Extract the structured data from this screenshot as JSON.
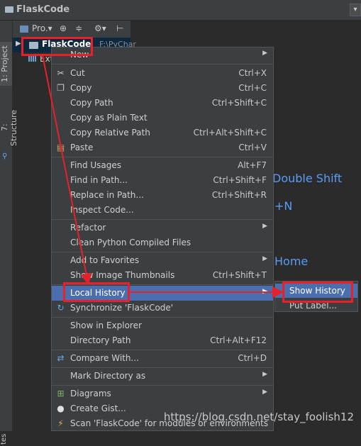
{
  "window": {
    "title": "FlaskCode",
    "dropdown_glyph": "▾"
  },
  "side_tabs": {
    "project": "1: Project",
    "structure": "7: Structure",
    "bottom": "tes"
  },
  "toolbar": {
    "project_label": "Pro.▾",
    "icons": [
      "⊕",
      "≑",
      "⚙▾",
      "⊢"
    ]
  },
  "tree": {
    "root_name": "FlaskCode",
    "root_path": "F:\\PyChar",
    "external_libs": "Ext"
  },
  "hints": {
    "double_shift": "Double Shift",
    "n": "+N",
    "home": "Home"
  },
  "context_menu": {
    "items": [
      {
        "label": "New",
        "shortcut": "",
        "submenu": true,
        "icon": ""
      },
      {
        "label": "Cut",
        "shortcut": "Ctrl+X",
        "submenu": false,
        "icon": "scissors-icon"
      },
      {
        "label": "Copy",
        "shortcut": "Ctrl+C",
        "submenu": false,
        "icon": "copy-icon"
      },
      {
        "label": "Copy Path",
        "shortcut": "Ctrl+Shift+C",
        "submenu": false,
        "icon": ""
      },
      {
        "label": "Copy as Plain Text",
        "shortcut": "",
        "submenu": false,
        "icon": ""
      },
      {
        "label": "Copy Relative Path",
        "shortcut": "Ctrl+Alt+Shift+C",
        "submenu": false,
        "icon": ""
      },
      {
        "label": "Paste",
        "shortcut": "Ctrl+V",
        "submenu": false,
        "icon": "paste-icon"
      },
      {
        "label": "Find Usages",
        "shortcut": "Alt+F7",
        "submenu": false,
        "icon": ""
      },
      {
        "label": "Find in Path...",
        "shortcut": "Ctrl+Shift+F",
        "submenu": false,
        "icon": ""
      },
      {
        "label": "Replace in Path...",
        "shortcut": "Ctrl+Shift+R",
        "submenu": false,
        "icon": ""
      },
      {
        "label": "Inspect Code...",
        "shortcut": "",
        "submenu": false,
        "icon": ""
      },
      {
        "label": "Refactor",
        "shortcut": "",
        "submenu": true,
        "icon": ""
      },
      {
        "label": "Clean Python Compiled Files",
        "shortcut": "",
        "submenu": false,
        "icon": ""
      },
      {
        "label": "Add to Favorites",
        "shortcut": "",
        "submenu": true,
        "icon": ""
      },
      {
        "label": "Show Image Thumbnails",
        "shortcut": "Ctrl+Shift+T",
        "submenu": false,
        "icon": ""
      },
      {
        "label": "Local History",
        "shortcut": "",
        "submenu": true,
        "icon": ""
      },
      {
        "label": "Synchronize 'FlaskCode'",
        "shortcut": "",
        "submenu": false,
        "icon": "sync-icon"
      },
      {
        "label": "Show in Explorer",
        "shortcut": "",
        "submenu": false,
        "icon": ""
      },
      {
        "label": "Directory Path",
        "shortcut": "Ctrl+Alt+F12",
        "submenu": false,
        "icon": ""
      },
      {
        "label": "Compare With...",
        "shortcut": "Ctrl+D",
        "submenu": false,
        "icon": "compare-icon"
      },
      {
        "label": "Mark Directory as",
        "shortcut": "",
        "submenu": true,
        "icon": ""
      },
      {
        "label": "Diagrams",
        "shortcut": "",
        "submenu": true,
        "icon": "diagram-icon"
      },
      {
        "label": "Create Gist...",
        "shortcut": "",
        "submenu": false,
        "icon": "github-icon"
      },
      {
        "label": "Scan 'FlaskCode' for modules or environments",
        "shortcut": "",
        "submenu": false,
        "icon": "scan-icon"
      }
    ],
    "submenu_glyph": "▶"
  },
  "local_history_submenu": {
    "items": [
      "Show History",
      "Put Label..."
    ]
  },
  "watermark": "https://blog.csdn.net/stay_foolish12",
  "colors": {
    "accent": "#4b6eaf",
    "annotation": "#e8202a",
    "link": "#589df6"
  }
}
